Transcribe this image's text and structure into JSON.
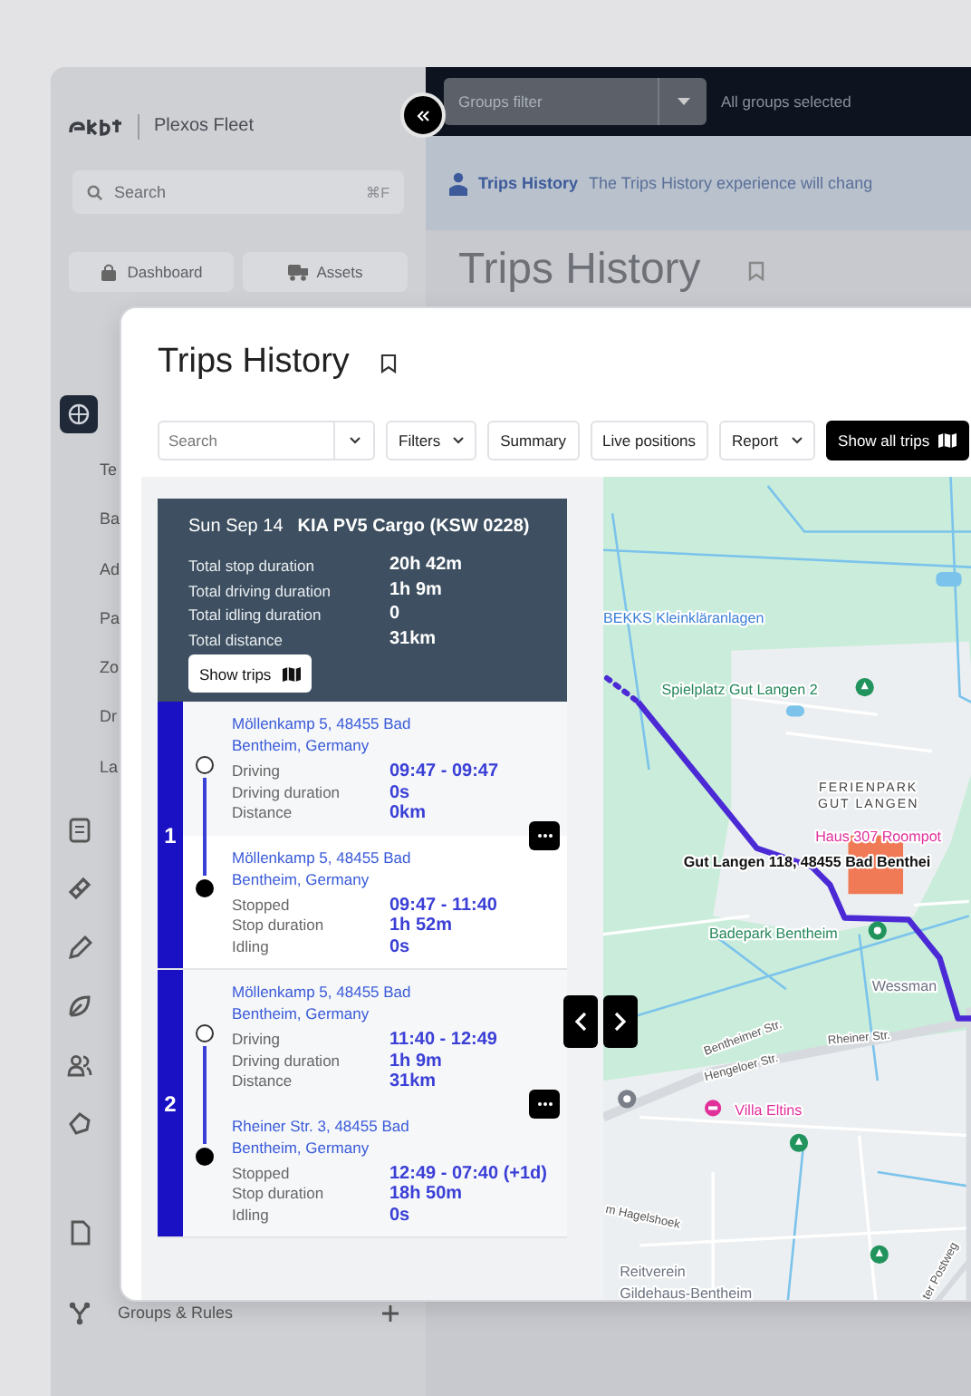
{
  "app": {
    "brand": "Plexos Fleet",
    "search": {
      "placeholder": "Search",
      "shortcut": "⌘F"
    },
    "quick_buttons": [
      "Dashboard",
      "Assets"
    ],
    "nav_items": [
      "Te",
      "Ba",
      "Ad",
      "Pa",
      "Zo",
      "Dr",
      "La"
    ],
    "footer_item": "Groups & Rules",
    "groups_filter": {
      "placeholder": "Groups filter"
    },
    "groups_status": "All groups selected",
    "banner": {
      "title": "Trips History",
      "text": "The Trips History experience will chang"
    },
    "page_title": "Trips History"
  },
  "panel": {
    "title": "Trips History",
    "search": {
      "placeholder": "Search"
    },
    "toolbar": [
      {
        "label": "Filters",
        "kind": "dropdown"
      },
      {
        "label": "Summary",
        "kind": "button"
      },
      {
        "label": "Live positions",
        "kind": "button"
      },
      {
        "label": "Report",
        "kind": "dropdown"
      },
      {
        "label": "Show all trips",
        "kind": "primary"
      }
    ],
    "summary": {
      "date": "Sun Sep 14",
      "vehicle": "KIA PV5 Cargo (KSW 0228)",
      "button": "Show trips",
      "rows": [
        {
          "label": "Total stop duration",
          "value": "20h 42m"
        },
        {
          "label": "Total driving duration",
          "value": "1h 9m"
        },
        {
          "label": "Total idling duration",
          "value": "0"
        },
        {
          "label": "Total distance",
          "value": "31km"
        }
      ]
    },
    "trips": [
      {
        "number": "1",
        "segments": [
          {
            "kind": "driving",
            "address": "Möllenkamp 5, 48455 Bad Bentheim, Germany",
            "rows": [
              {
                "label": "Driving",
                "value": "09:47 - 09:47"
              },
              {
                "label": "Driving duration",
                "value": "0s"
              },
              {
                "label": "Distance",
                "value": "0km"
              }
            ]
          },
          {
            "kind": "stopped",
            "address": "Möllenkamp 5, 48455 Bad Bentheim, Germany",
            "rows": [
              {
                "label": "Stopped",
                "value": "09:47 - 11:40"
              },
              {
                "label": "Stop duration",
                "value": "1h 52m"
              },
              {
                "label": "Idling",
                "value": "0s"
              }
            ]
          }
        ]
      },
      {
        "number": "2",
        "segments": [
          {
            "kind": "driving",
            "address": "Möllenkamp 5, 48455 Bad Bentheim, Germany",
            "rows": [
              {
                "label": "Driving",
                "value": "11:40 - 12:49"
              },
              {
                "label": "Driving duration",
                "value": "1h 9m"
              },
              {
                "label": "Distance",
                "value": "31km"
              }
            ]
          },
          {
            "kind": "stopped",
            "address": "Rheiner Str. 3, 48455 Bad Bentheim, Germany",
            "rows": [
              {
                "label": "Stopped",
                "value": "12:49 - 07:40 (+1d)"
              },
              {
                "label": "Stop duration",
                "value": "18h 50m"
              },
              {
                "label": "Idling",
                "value": "0s"
              }
            ]
          }
        ]
      }
    ],
    "map": {
      "labels": [
        {
          "text": "BEKKS Kleinkläranlagen",
          "kind": "water"
        },
        {
          "text": "Spielplatz Gut Langen 2",
          "kind": "park"
        },
        {
          "text": "FERIENPARK",
          "kind": "area"
        },
        {
          "text": "GUT LANGEN",
          "kind": "area"
        },
        {
          "text": "Haus 307 Roompot",
          "kind": "lodging"
        },
        {
          "text": "Badepark Bentheim",
          "kind": "park"
        },
        {
          "text": "Wessman",
          "kind": "place"
        },
        {
          "text": "Bentheimer Str.",
          "kind": "road"
        },
        {
          "text": "Hengeloer Str.",
          "kind": "road"
        },
        {
          "text": "Rheiner Str.",
          "kind": "road"
        },
        {
          "text": "Villa Eltins",
          "kind": "lodging"
        },
        {
          "text": "m Hagelshoek",
          "kind": "road"
        },
        {
          "text": "Reitverein",
          "kind": "place"
        },
        {
          "text": "Gildehaus-Bentheim",
          "kind": "place"
        },
        {
          "text": "ter Postweg",
          "kind": "road"
        },
        {
          "text": "Gut Langen 118, 48455 Bad Benthei",
          "kind": "address"
        }
      ]
    }
  }
}
